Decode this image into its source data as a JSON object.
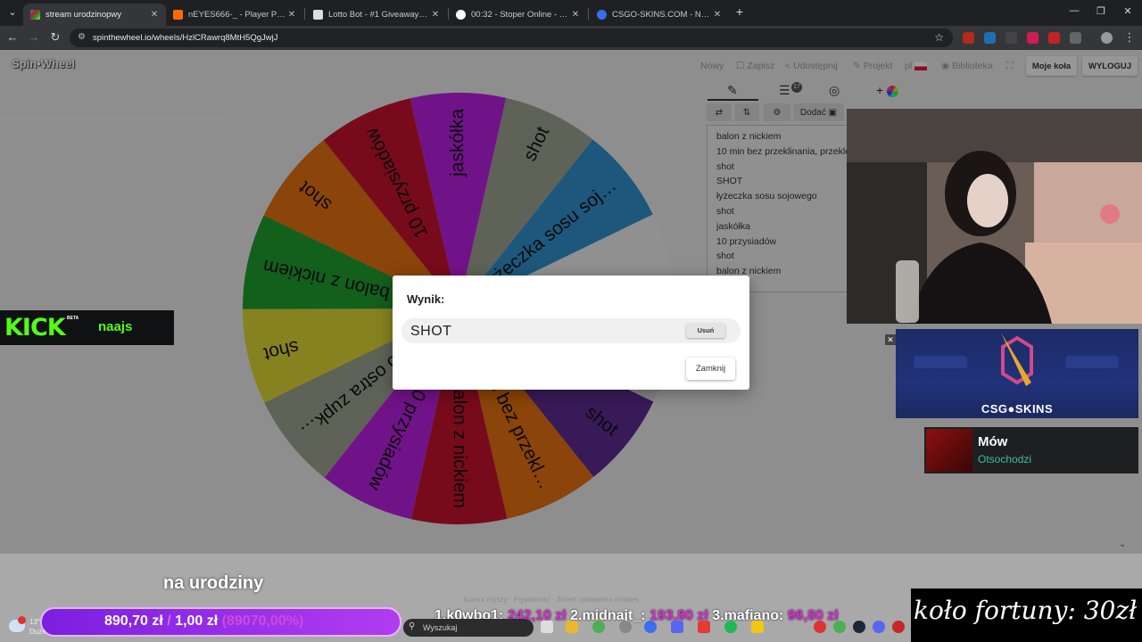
{
  "browser": {
    "tabs": [
      {
        "title": "stream urodzinopwy",
        "active": true,
        "color": "#e8e8e8"
      },
      {
        "title": "nEYES666-_ - Player Profile - F",
        "active": false,
        "color": "#ff6a00"
      },
      {
        "title": "Lotto Bot - #1 Giveaway Bot fo",
        "active": false,
        "color": "#dddddd"
      },
      {
        "title": "00:32 - Stoper Online - ZegarO",
        "active": false,
        "color": "#ffffff"
      },
      {
        "title": "CSGO-SKINS.COM - Najlepsze",
        "active": false,
        "color": "#3a6df0"
      }
    ],
    "url": "spinthewheel.io/wheels/HzlCRawrq8MtH5QgJwjJ"
  },
  "app": {
    "logo": "Spin•Wheel",
    "menu": {
      "new": "Nowy",
      "save": "Zapisz",
      "share": "Udostępnij",
      "design": "Projekt",
      "lang": "pl",
      "library": "Biblioteka",
      "my_wheels": "Moje koła",
      "logout": "WYLOGUJ"
    },
    "editor": {
      "badge": "17",
      "add_label": "Dodać",
      "entries": [
        "balon z nickiem",
        "10 min bez przeklinania, przeklenst",
        "shot",
        "SHOT",
        "łyżeczka sosu sojowego",
        "shot",
        "jaskółka",
        "10 przysiadów",
        "shot",
        "balon z nickiem"
      ]
    },
    "wheel": {
      "segments": [
        {
          "label": "jaskółka",
          "color": "#b61fdc"
        },
        {
          "label": "shot",
          "color": "#9a9f8d"
        },
        {
          "label": "łyżeczka sosu soj…",
          "color": "#2f8fc9"
        },
        {
          "label": "",
          "color": "#e9e9e9"
        },
        {
          "label": "",
          "color": "#d7d7d7"
        },
        {
          "label": "shot",
          "color": "#5b2a8f"
        },
        {
          "label": "10 min bez przekl…",
          "color": "#e06f0f"
        },
        {
          "label": "balon z nickiem",
          "color": "#c0132c"
        },
        {
          "label": "10 przysiadów",
          "color": "#b61fdc"
        },
        {
          "label": "…o ostra zupk…",
          "color": "#9a9f8d"
        },
        {
          "label": "shot",
          "color": "#d8d235"
        },
        {
          "label": "balon z nickiem",
          "color": "#1f9a2e"
        },
        {
          "label": "shot",
          "color": "#e06f0f"
        },
        {
          "label": "10 przysiadów",
          "color": "#c0132c"
        }
      ]
    },
    "dialog": {
      "title": "Wynik:",
      "result": "SHOT",
      "remove": "Usuń",
      "close": "Zamknij"
    }
  },
  "stream": {
    "kick": {
      "logo": "KICK",
      "beta": "BETA",
      "user": "naajs"
    },
    "sponsor": "CSG●SKINS",
    "music": {
      "title": "Mów",
      "artist": "Otsochodzi"
    },
    "birthday": "na urodziny",
    "goal": {
      "current": "890,70 zł",
      "target": "1,00 zł",
      "percent": "(89070,00%)"
    },
    "leaderboard": [
      {
        "rank": "1.",
        "name": "k0wbo1:",
        "amount": "242,10 zł"
      },
      {
        "rank": "2.",
        "name": "midnajt_:",
        "amount": "193,80 zł"
      },
      {
        "rank": "3.",
        "name": "mafiano:",
        "amount": "96,80 zł"
      }
    ],
    "kolo": "koło fortuny: 30zł",
    "faint_footer": "Kursor myszy · Prywatność · Zmień ustawienia cookies"
  },
  "taskbar": {
    "weather_temp": "13°",
    "weather_desc": "Duże",
    "search_placeholder": "Wyszukaj"
  }
}
